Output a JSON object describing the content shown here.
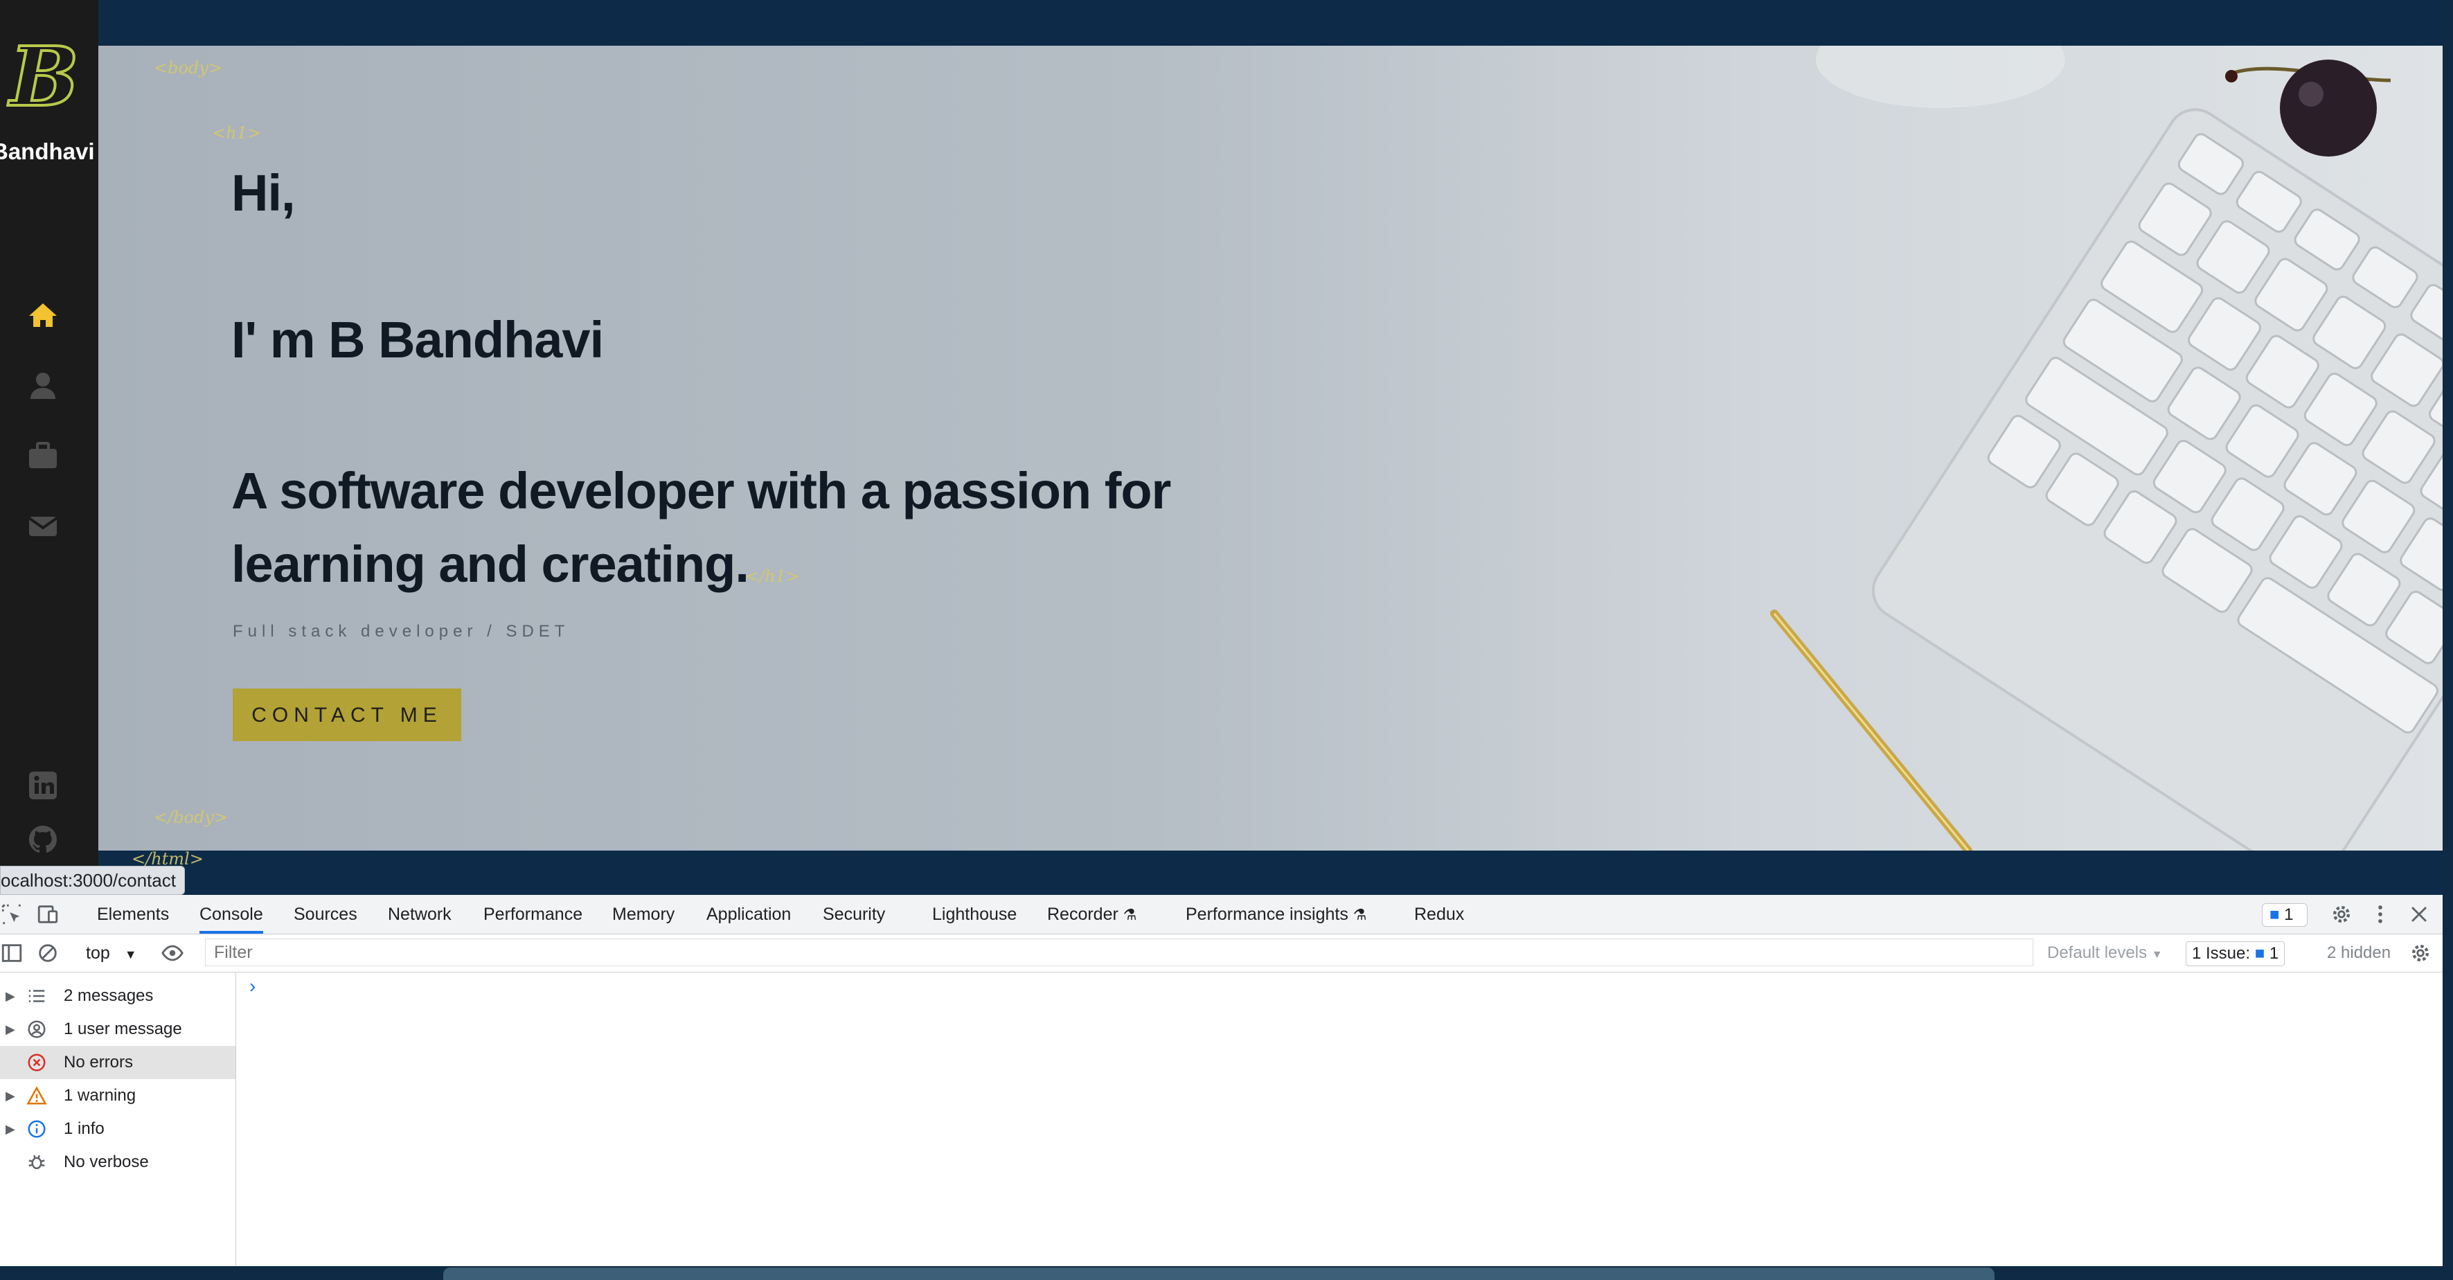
{
  "site": {
    "logo_letter": "B",
    "logo_name": "Bandhavi",
    "tags": {
      "body_open": "<body>",
      "h1_open": "<h1>",
      "h1_close": "</h1>",
      "body_close": "</body>",
      "html_close": "</html>"
    },
    "hero": {
      "greeting": "Hi,",
      "intro": "I' m B Bandhavi",
      "tagline": "A software developer with a passion for learning and creating.",
      "role": "Full stack developer / SDET",
      "cta_label": "CONTACT ME"
    },
    "nav_icons": [
      "home-icon",
      "user-icon",
      "briefcase-icon",
      "mail-icon",
      "linkedin-icon",
      "github-icon"
    ],
    "accent_color": "#f2c230",
    "sidebar_color": "#1b1b1b"
  },
  "status_url": "ocalhost:3000/contact",
  "devtools": {
    "tabs": [
      "Elements",
      "Console",
      "Sources",
      "Network",
      "Performance",
      "Memory",
      "Application",
      "Security",
      "Lighthouse",
      "Recorder",
      "Performance insights",
      "Redux"
    ],
    "active_tab": "Console",
    "issue_badge_count": "1",
    "toolbar": {
      "context": "top",
      "filter_placeholder": "Filter",
      "levels_label": "Default levels",
      "issues_label": "1 Issue:",
      "issues_count": "1",
      "hidden_label": "2 hidden"
    },
    "sidebar": [
      {
        "label": "2 messages",
        "icon": "list-icon",
        "expandable": true
      },
      {
        "label": "1 user message",
        "icon": "user-circle-icon",
        "expandable": true
      },
      {
        "label": "No errors",
        "icon": "error-icon",
        "expandable": false
      },
      {
        "label": "1 warning",
        "icon": "warning-icon",
        "expandable": true
      },
      {
        "label": "1 info",
        "icon": "info-icon",
        "expandable": true
      },
      {
        "label": "No verbose",
        "icon": "bug-icon",
        "expandable": false
      }
    ],
    "prompt_symbol": "›"
  }
}
